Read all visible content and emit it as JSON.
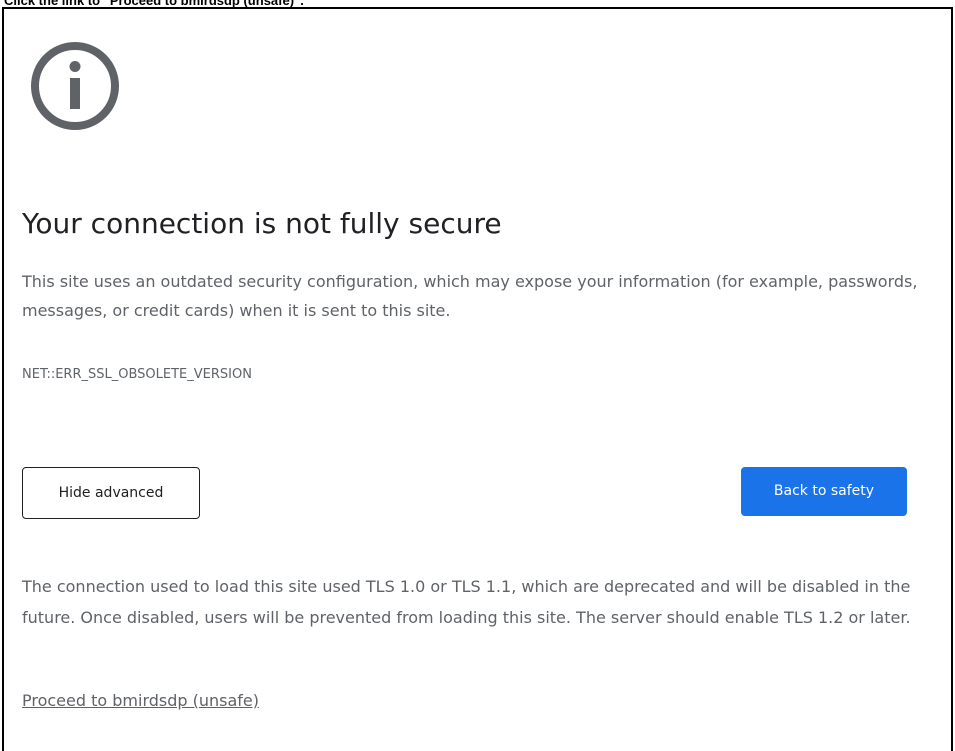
{
  "instruction": {
    "text": "Click the link to \"Proceed to bmirdsdp (unsafe)\"."
  },
  "icon": {
    "name": "info-icon",
    "color": "#5f6368"
  },
  "main": {
    "heading": "Your connection is not fully secure",
    "explanation": "This site uses an outdated security configuration, which may expose your information (for example, passwords, messages, or credit cards) when it is sent to this site.",
    "error_code": "NET::ERR_SSL_OBSOLETE_VERSION"
  },
  "buttons": {
    "hide_advanced_label": "Hide advanced",
    "back_to_safety_label": "Back to safety"
  },
  "advanced": {
    "details": "The connection used to load this site used TLS 1.0 or TLS 1.1, which are deprecated and will be disabled in the future. Once disabled, users will be prevented from loading this site. The server should enable TLS 1.2 or later.",
    "proceed_link": "Proceed to bmirdsdp (unsafe)"
  },
  "colors": {
    "primary_button": "#1a73e8",
    "text_primary": "#202124",
    "text_secondary": "#5f6368"
  }
}
